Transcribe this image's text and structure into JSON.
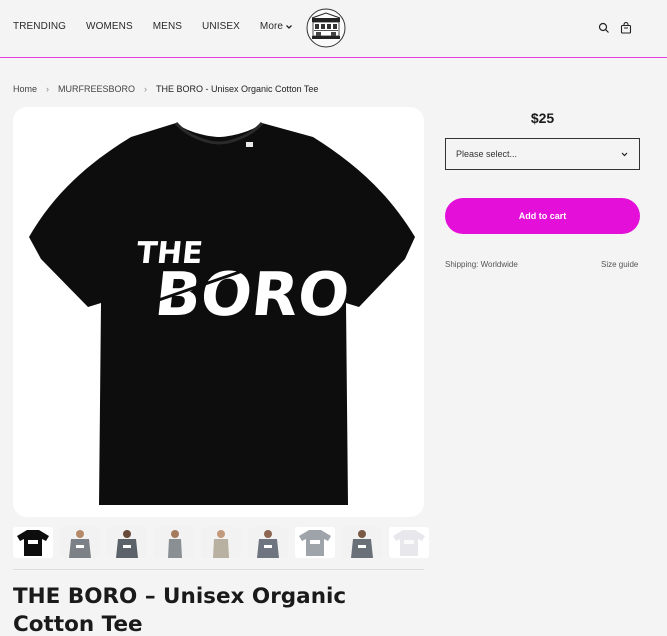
{
  "header": {
    "nav": [
      {
        "label": "TRENDING"
      },
      {
        "label": "WOMENS"
      },
      {
        "label": "MENS"
      },
      {
        "label": "UNISEX"
      },
      {
        "label": "More"
      }
    ],
    "icons": {
      "search": "search-icon",
      "cart": "cart-icon",
      "more": "chevron-down-icon"
    }
  },
  "breadcrumb": {
    "home": "Home",
    "category": "MURFREESBORO",
    "current": "THE BORO - Unisex Organic Cotton Tee"
  },
  "product": {
    "title": "THE BORO – Unisex Organic Cotton Tee",
    "price": "$25",
    "select_placeholder": "Please select...",
    "add_to_cart": "Add to cart",
    "shipping": "Shipping: Worldwide",
    "size_guide": "Size guide",
    "image_text_line1": "THE",
    "image_text_line2": "BORO"
  },
  "colors": {
    "accent": "#e40fd9",
    "header_rule": "#e63be0",
    "background": "#f4f4f4",
    "shirt": "#0d0d0d"
  },
  "thumbnails": [
    {
      "variant": "black tee flat"
    },
    {
      "variant": "model grey front"
    },
    {
      "variant": "model grey front 2"
    },
    {
      "variant": "model side"
    },
    {
      "variant": "model beige"
    },
    {
      "variant": "model grey 3"
    },
    {
      "variant": "grey tee flat"
    },
    {
      "variant": "model grey 4"
    },
    {
      "variant": "white tee flat"
    }
  ]
}
